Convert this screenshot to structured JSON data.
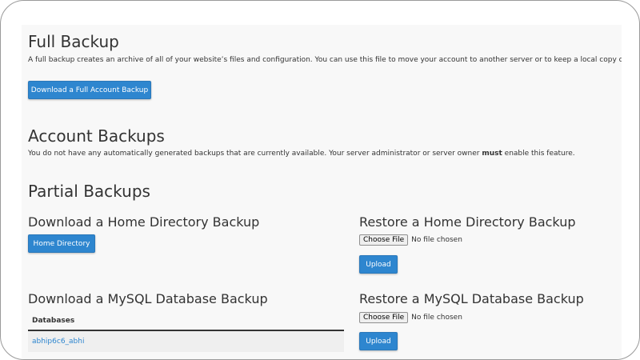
{
  "full_backup": {
    "title": "Full Backup",
    "description": "A full backup creates an archive of all of your website’s files and configuration. You can use this file to move your account to another server or to keep a local copy of your files.",
    "button_label": "Download a Full Account Backup"
  },
  "account_backups": {
    "title": "Account Backups",
    "description_before": "You do not have any automatically generated backups that are currently available. Your server administrator or server owner ",
    "description_emphasis": "must",
    "description_after": " enable this feature."
  },
  "partial_backups": {
    "title": "Partial Backups",
    "home_download": {
      "title": "Download a Home Directory Backup",
      "button_label": "Home Directory"
    },
    "home_restore": {
      "title": "Restore a Home Directory Backup",
      "choose_label": "Choose File",
      "file_status": "No file chosen",
      "upload_label": "Upload"
    },
    "mysql_download": {
      "title": "Download a MySQL Database Backup",
      "table_header": "Databases",
      "databases": [
        "abhip6c6_abhi"
      ]
    },
    "mysql_restore": {
      "title": "Restore a MySQL Database Backup",
      "choose_label": "Choose File",
      "file_status": "No file chosen",
      "upload_label": "Upload"
    }
  },
  "colors": {
    "primary_button": "#2e86cf",
    "link": "#2e86cf",
    "panel_background": "#f8f8f8"
  }
}
